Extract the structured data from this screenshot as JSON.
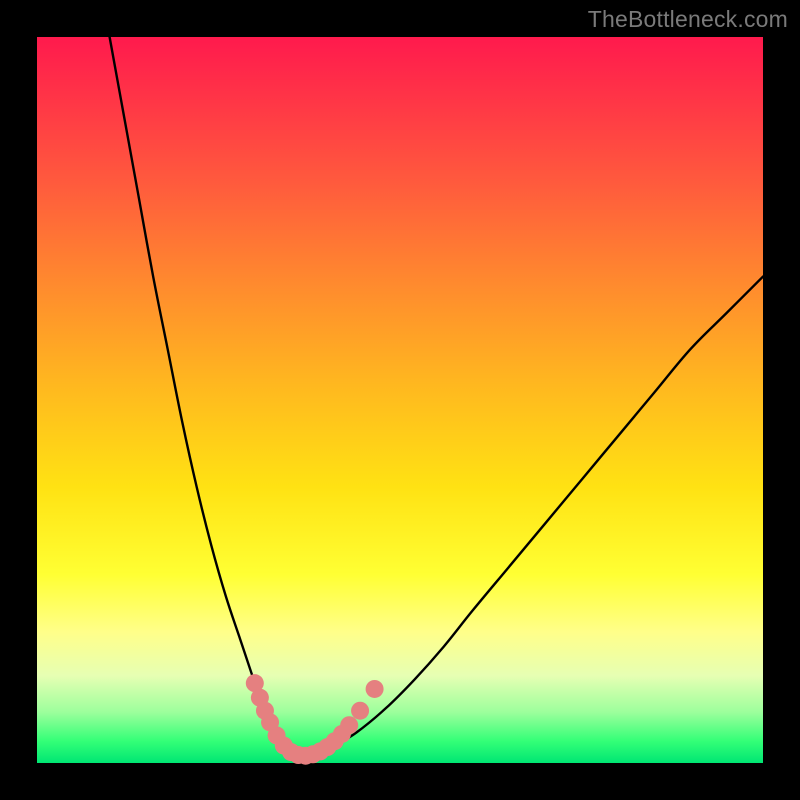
{
  "watermark": "TheBottleneck.com",
  "chart_data": {
    "type": "line",
    "title": "",
    "xlabel": "",
    "ylabel": "",
    "xlim": [
      0,
      100
    ],
    "ylim": [
      0,
      100
    ],
    "grid": false,
    "series": [
      {
        "name": "bottleneck-curve",
        "x": [
          10,
          12,
          14,
          16,
          18,
          20,
          22,
          24,
          26,
          28,
          30,
          31,
          32,
          33,
          34,
          35,
          36,
          37,
          39,
          41,
          44,
          48,
          52,
          56,
          60,
          65,
          70,
          75,
          80,
          85,
          90,
          95,
          100
        ],
        "y": [
          100,
          89,
          78,
          67,
          57,
          47,
          38,
          30,
          23,
          17,
          11,
          8,
          5.5,
          3.5,
          2.2,
          1.4,
          1.0,
          1.0,
          1.4,
          2.4,
          4.2,
          7.5,
          11.5,
          16,
          21,
          27,
          33,
          39,
          45,
          51,
          57,
          62,
          67
        ]
      }
    ],
    "markers": [
      {
        "name": "marker-left-1",
        "x": 30.0,
        "y": 11.0
      },
      {
        "name": "marker-left-2",
        "x": 30.7,
        "y": 9.0
      },
      {
        "name": "marker-left-3",
        "x": 31.4,
        "y": 7.2
      },
      {
        "name": "marker-left-4",
        "x": 32.1,
        "y": 5.6
      },
      {
        "name": "marker-valley-1",
        "x": 33.0,
        "y": 3.8
      },
      {
        "name": "marker-valley-2",
        "x": 34.0,
        "y": 2.4
      },
      {
        "name": "marker-valley-3",
        "x": 35.0,
        "y": 1.5
      },
      {
        "name": "marker-valley-4",
        "x": 36.0,
        "y": 1.1
      },
      {
        "name": "marker-valley-5",
        "x": 37.0,
        "y": 1.0
      },
      {
        "name": "marker-valley-6",
        "x": 38.0,
        "y": 1.2
      },
      {
        "name": "marker-right-1",
        "x": 39.0,
        "y": 1.6
      },
      {
        "name": "marker-right-2",
        "x": 40.0,
        "y": 2.2
      },
      {
        "name": "marker-right-3",
        "x": 41.0,
        "y": 3.0
      },
      {
        "name": "marker-right-4",
        "x": 42.0,
        "y": 4.0
      },
      {
        "name": "marker-right-5",
        "x": 43.0,
        "y": 5.2
      },
      {
        "name": "marker-right-6",
        "x": 44.5,
        "y": 7.2
      },
      {
        "name": "marker-right-7",
        "x": 46.5,
        "y": 10.2
      }
    ],
    "marker_color": "#e58080",
    "curve_color": "#000000"
  }
}
